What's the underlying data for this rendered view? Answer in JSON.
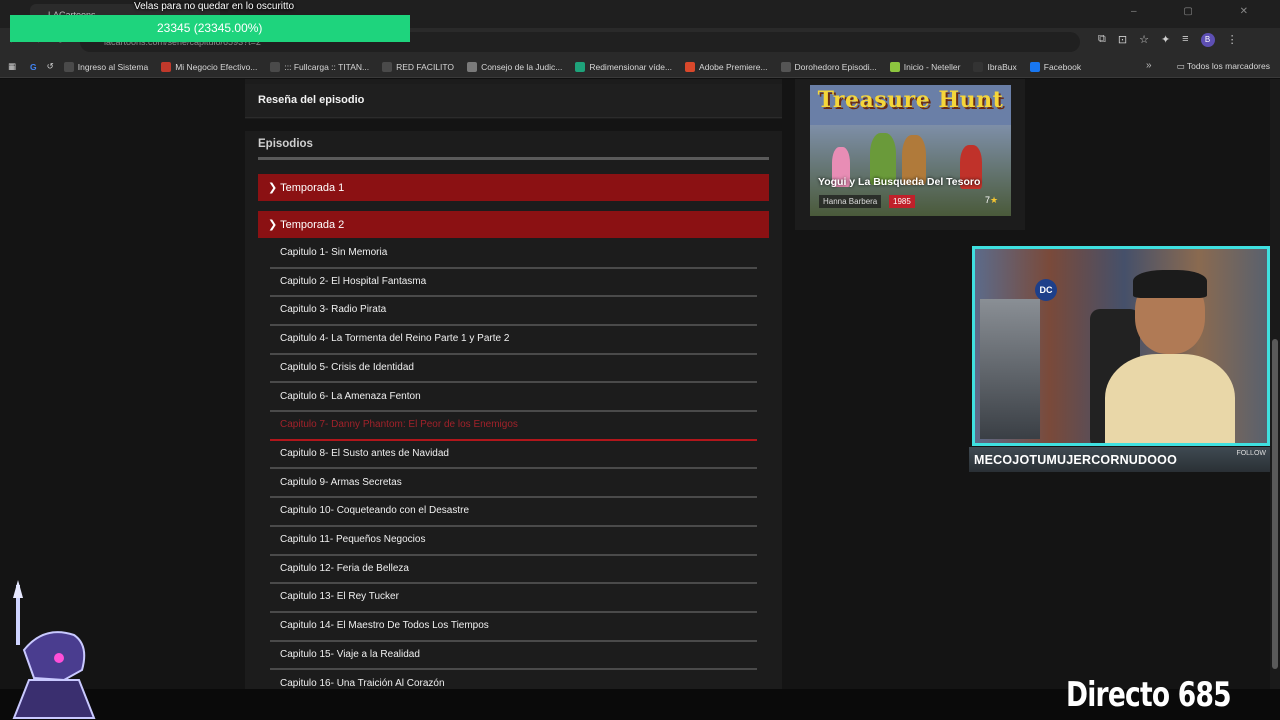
{
  "browser": {
    "tab_title": "LACartoons",
    "url": "lacartoons.com/serie/capitulo/6593?t=2",
    "bookmarks": [
      {
        "label": "Ingreso al Sistema",
        "color": "#4a4a4a"
      },
      {
        "label": "Mi Negocio Efectivo...",
        "color": "#c0392b"
      },
      {
        "label": "::: Fullcarga :: TITAN...",
        "color": "#4a4a4a"
      },
      {
        "label": "RED FACILITO",
        "color": "#4a4a4a"
      },
      {
        "label": "Consejo de la Judic...",
        "color": "#7a7a7a"
      },
      {
        "label": "Redimensionar víde...",
        "color": "#1ea27a"
      },
      {
        "label": "Adobe Premiere...",
        "color": "#d9482b"
      },
      {
        "label": "Dorohedoro Episodi...",
        "color": "#555"
      },
      {
        "label": "Inicio - Neteller",
        "color": "#8dc63f"
      },
      {
        "label": "IbraBux",
        "color": "#333"
      },
      {
        "label": "Facebook",
        "color": "#1877f2"
      }
    ],
    "all_bookmarks_label": "Todos los marcadores",
    "profile_initial": "B"
  },
  "overlay": {
    "donation_title": "Velas para no quedar en lo oscuritto",
    "donation_progress": "23345 (23345.00%)",
    "donation_color": "#1ed47d",
    "streamer_name": "MECOJOTUMUJERCORNUDOOO",
    "follow_label": "FOLLOW",
    "stream_number": "Directo 685"
  },
  "page": {
    "review_label": "Reseña del episodio",
    "episodes_heading": "Episodios",
    "season1": "Temporada 1",
    "season2": "Temporada 2",
    "episodes": [
      "Capitulo 1- Sin Memoria",
      "Capitulo 2- El Hospital Fantasma",
      "Capitulo 3- Radio Pirata",
      "Capitulo 4- La Tormenta del Reino Parte 1 y Parte 2",
      "Capitulo 5- Crisis de Identidad",
      "Capitulo 6- La Amenaza Fenton",
      "Capitulo 7- Danny Phantom: El Peor de los Enemigos",
      "Capitulo 8- El Susto antes de Navidad",
      "Capitulo 9- Armas Secretas",
      "Capitulo 10- Coqueteando con el Desastre",
      "Capitulo 11- Pequeños Negocios",
      "Capitulo 12- Feria de Belleza",
      "Capitulo 13- El Rey Tucker",
      "Capitulo 14- El Maestro De Todos Los Tiempos",
      "Capitulo 15- Viaje a la Realidad",
      "Capitulo 16- Una Traición Al Corazón"
    ],
    "active_episode_index": 6,
    "season_color": "#8b1113"
  },
  "sidebar_card": {
    "poster_title": "Treasure Hunt",
    "show_title": "Yogui y La Busqueda Del Tesoro",
    "studio": "Hanna Barbera",
    "year": "1985",
    "rating": "7"
  }
}
